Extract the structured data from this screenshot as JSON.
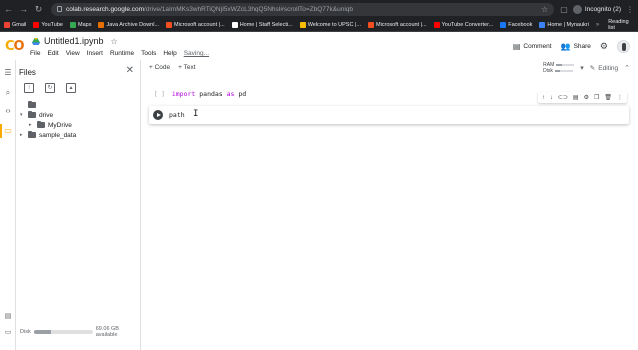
{
  "browser": {
    "url_host": "colab.research.google.com",
    "url_path": "/drive/1aImMKs3whRTiQNjI5xWZcL3hqQ5Nhsl#scrollTo=ZbQ77k&uniqb",
    "profile_label": "Incognito (2)",
    "bookmarks": [
      {
        "label": "Gmail",
        "color": "#ea4335"
      },
      {
        "label": "YouTube",
        "color": "#ff0000"
      },
      {
        "label": "Maps",
        "color": "#34a853"
      },
      {
        "label": "Java Archive Downl...",
        "color": "#e76f00"
      },
      {
        "label": "Microsoft account |...",
        "color": "#f25022"
      },
      {
        "label": "Home | Staff Selecti...",
        "color": "#ffffff"
      },
      {
        "label": "Welcome to UPSC |...",
        "color": "#fbbc04"
      },
      {
        "label": "Microsoft account |...",
        "color": "#f25022"
      },
      {
        "label": "YouTube Converter...",
        "color": "#ff0000"
      },
      {
        "label": "Facebook",
        "color": "#1877f2"
      },
      {
        "label": "Home | Mynaukri",
        "color": "#3b82f6"
      }
    ],
    "reading_list": "Reading list"
  },
  "colab": {
    "notebook_name": "Untitled1.ipynb",
    "menu": [
      "File",
      "Edit",
      "View",
      "Insert",
      "Runtime",
      "Tools",
      "Help"
    ],
    "saving_label": "Saving...",
    "comment_label": "Comment",
    "share_label": "Share"
  },
  "files_panel": {
    "title": "Files",
    "tree": [
      {
        "label": "",
        "indent": 0,
        "caret": ""
      },
      {
        "label": "drive",
        "indent": 0,
        "caret": "▾"
      },
      {
        "label": "MyDrive",
        "indent": 1,
        "caret": "▸"
      },
      {
        "label": "sample_data",
        "indent": 0,
        "caret": "▸"
      }
    ],
    "disk_label": "Disk",
    "disk_available": "69.06 GB available",
    "disk_used_fraction": 0.3
  },
  "notebook": {
    "add_code": "+ Code",
    "add_text": "+ Text",
    "ram_label": "RAM",
    "disk_label": "Disk",
    "editing_label": "Editing",
    "cell1_bracket": "[ ]",
    "cell1_keyword1": "import",
    "cell1_module": " pandas ",
    "cell1_keyword2": "as",
    "cell1_alias": " pd",
    "cell2_code": "path"
  }
}
